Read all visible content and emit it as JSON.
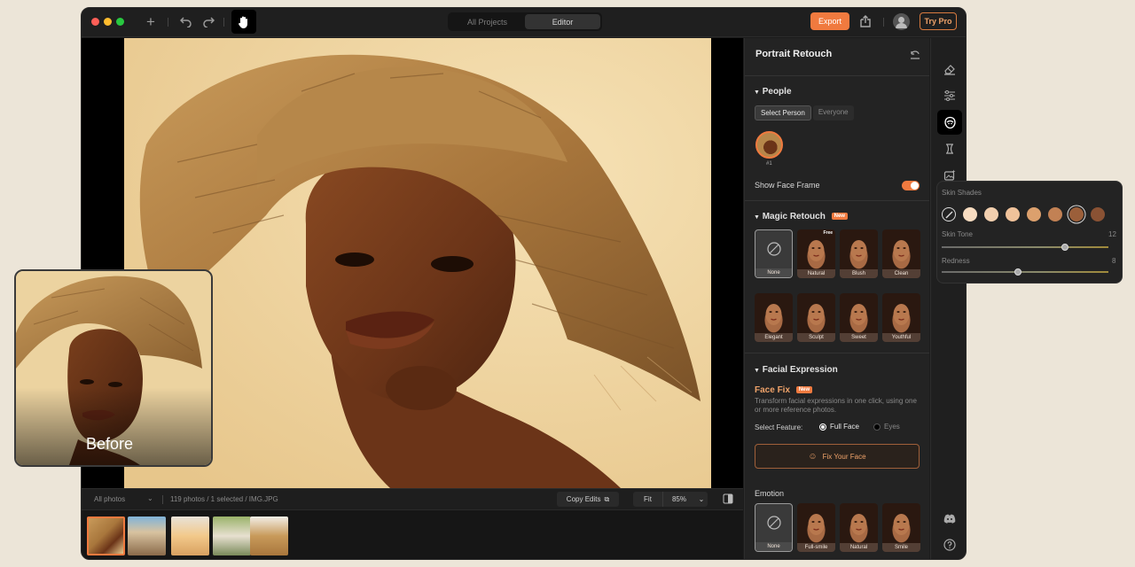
{
  "titlebar": {
    "tabs": [
      {
        "label": "All Projects"
      },
      {
        "label": "Editor"
      }
    ],
    "export_label": "Export",
    "trypro_label": "Try Pro"
  },
  "bottombar": {
    "filter_label": "All photos",
    "status": "119 photos / 1 selected / IMG.JPG",
    "copy_edits": "Copy Edits",
    "fit_label": "Fit",
    "zoom": "85%"
  },
  "panel": {
    "title": "Portrait Retouch",
    "people": {
      "heading": "People",
      "select_person": "Select Person",
      "everyone": "Everyone",
      "person_tag": "#1",
      "show_face_frame": "Show Face Frame",
      "show_face_frame_on": true
    },
    "magic": {
      "heading": "Magic Retouch",
      "new_tag": "New",
      "free_tag": "Free",
      "presets": [
        "None",
        "Natural",
        "Blush",
        "Clean",
        "Elegant",
        "Sculpt",
        "Sweet",
        "Youthful"
      ]
    },
    "facial": {
      "heading": "Facial Expression",
      "face_fix_title": "Face Fix",
      "new_tag": "New",
      "description": "Transform facial expressions in one click, using one or more reference photos.",
      "select_feature": "Select Feature:",
      "option_full": "Full Face",
      "option_eyes": "Eyes",
      "selected": "Full Face",
      "fix_button": "Fix Your Face",
      "emotion_heading": "Emotion",
      "emotions": [
        "None",
        "Full-smile",
        "Natural",
        "Smile"
      ]
    }
  },
  "before_label": "Before",
  "skin_popup": {
    "heading": "Skin Shades",
    "swatches": [
      "none",
      "#f7dcc0",
      "#f2cfae",
      "#f0c29a",
      "#dca06d",
      "#c28154",
      "#9b5f3a",
      "#8a5234"
    ],
    "selected_index": 6,
    "skin_tone_label": "Skin Tone",
    "skin_tone_value": "12",
    "skin_tone_fraction": 0.74,
    "redness_label": "Redness",
    "redness_value": "8",
    "redness_fraction": 0.46
  },
  "colors": {
    "accent": "#f07a3f",
    "window": "#1c1c1c",
    "panel": "#232323",
    "background": "#ece5d8"
  }
}
